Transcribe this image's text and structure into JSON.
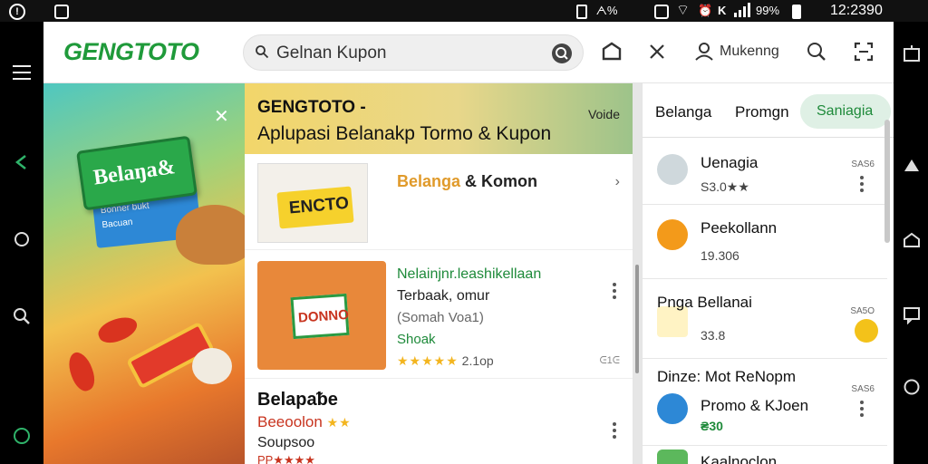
{
  "status_bar": {
    "left_badge": "!",
    "battery_small": "ᗅ%",
    "network_letter": "K",
    "battery_pct": "99%",
    "time": "12:2390"
  },
  "header": {
    "logo": "GENGTOTO",
    "search_value": "Gelnan Kupon",
    "search_placeholder": "Gelnan Kupon",
    "account_label": "Mukenng"
  },
  "banner": {
    "sign_text": "Belaŋa&",
    "card_lines": [
      "Bonner bukt",
      "Bacuan"
    ]
  },
  "middle": {
    "header_title": "GENGTOTO -",
    "header_subtitle": "Aplupasi Belanakp Tormo & Kupon",
    "header_link": "Voide",
    "card1": {
      "thumb_text": "ENCTO",
      "title_part1": "Belanga",
      "title_part2": "& Komon"
    },
    "card2": {
      "thumb_text": "DONNO",
      "line1": "Nelainjnr.leashikellaan",
      "line2": "Terbaak, omur",
      "line3": "(Somah Voa1)",
      "line4": "Shoak",
      "stars": "★★★★★",
      "rating": "2.1op",
      "small": "ᕮ1ᕮ"
    },
    "card3": {
      "title": "Belapaᵬe",
      "line2": "Beeoolon",
      "line2_stars": "★★",
      "line3": "Soupsoo",
      "line4": "PP★★★★"
    }
  },
  "right_panel": {
    "tabs": [
      "Belanga",
      "Promgn",
      "Saniagia"
    ],
    "items": [
      {
        "name": "Uenagia",
        "meta": "S3.0★★",
        "tag": "SAS6",
        "icon_color": "#cfd8dc"
      },
      {
        "name": "Peekollann",
        "meta": "19.306",
        "tag": "",
        "icon_color": "#f39a1a"
      },
      {
        "name": "Pnga   Bellanai",
        "meta": "33.8",
        "tag": "SA5O",
        "icon_color": "#f3c21a"
      },
      {
        "section": "Dinze: Mot ReNopm",
        "name": "Promo & KJoen",
        "meta": "₴30",
        "tag": "SAS6",
        "icon_color": "#2d88d6"
      },
      {
        "name": "Kaalnoclon",
        "meta": "",
        "tag": "",
        "icon_color": "#5cb85c"
      }
    ]
  },
  "colors": {
    "brand_green": "#1f9a3a",
    "accent_orange": "#e09a2a",
    "red": "#c8341f"
  }
}
